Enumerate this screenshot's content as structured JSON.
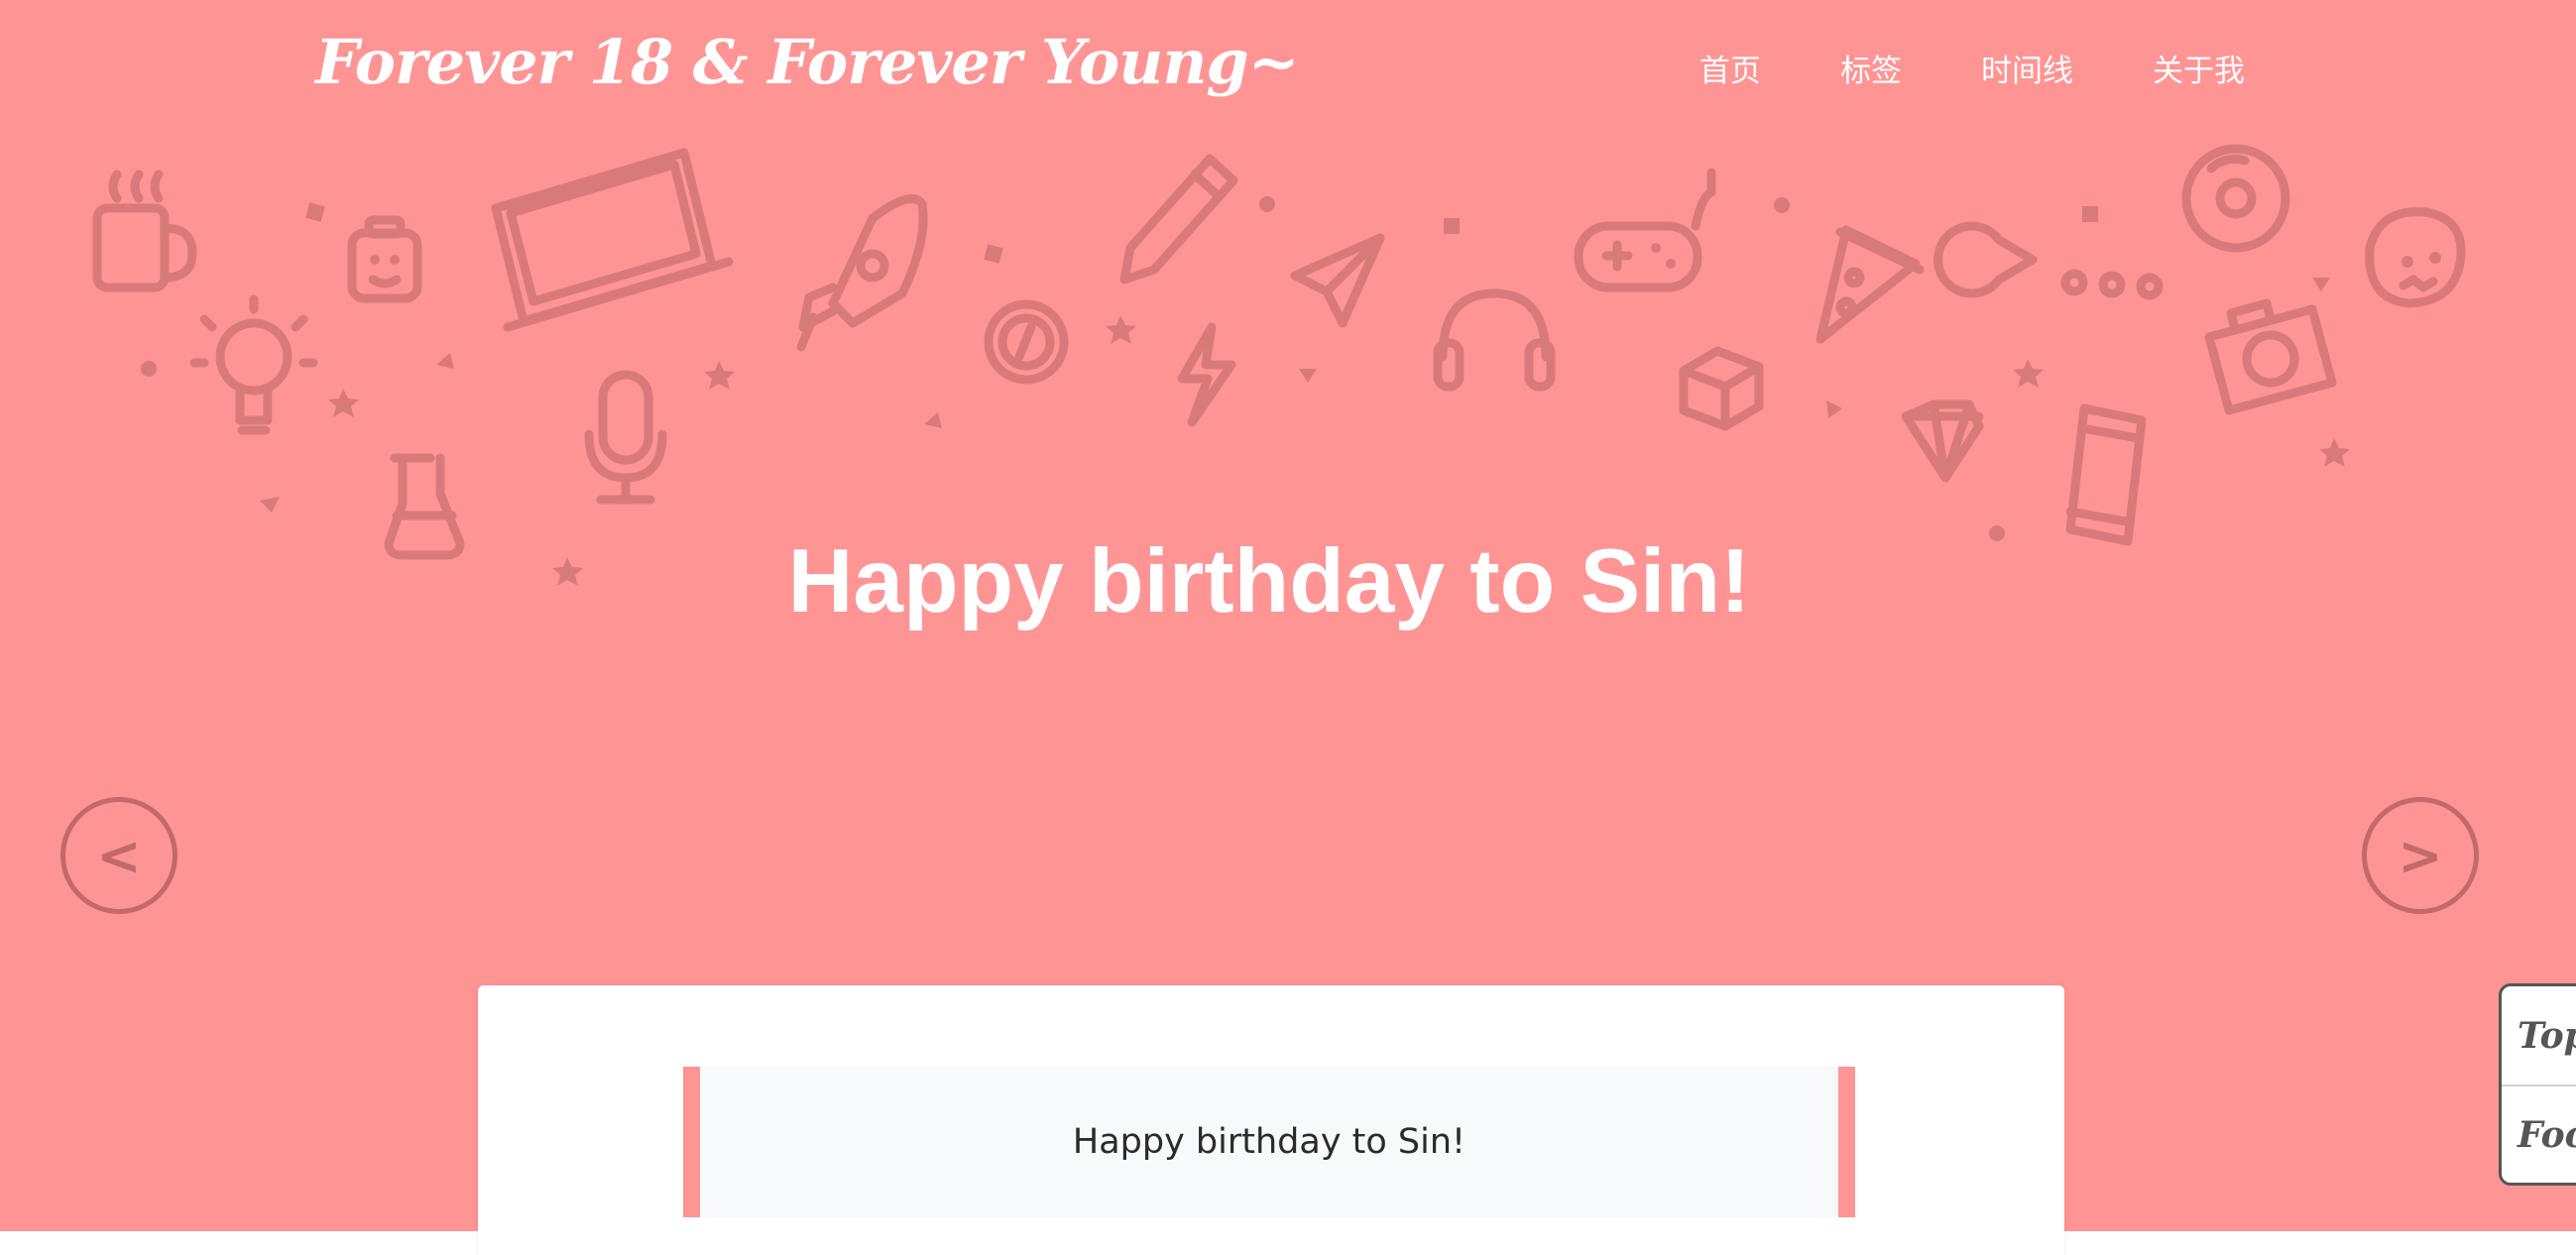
{
  "site": {
    "brand": "Forever 18 & Forever Young~"
  },
  "nav": {
    "items": [
      {
        "label": "首页"
      },
      {
        "label": "标签"
      },
      {
        "label": "时间线"
      },
      {
        "label": "关于我"
      }
    ]
  },
  "hero": {
    "headline": "Happy birthday to Sin!",
    "prev_label": "<",
    "next_label": ">",
    "background_color": "#ff9494"
  },
  "post": {
    "excerpt": "Happy birthday to Sin!"
  },
  "side_tools": {
    "top_label": "Top",
    "footer_label": "Footer"
  },
  "colors": {
    "accent": "#ff9494",
    "doodle": "#d97a7a",
    "arrow": "#c06a6a"
  }
}
